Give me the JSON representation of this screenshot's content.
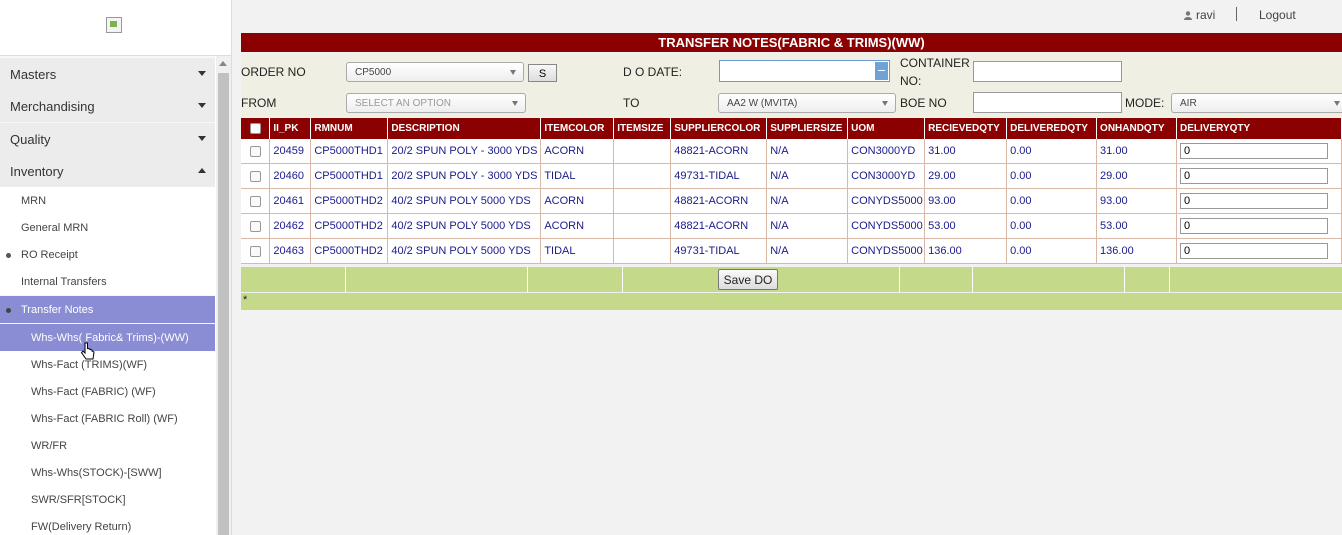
{
  "header": {
    "username": "ravi",
    "logout": "Logout"
  },
  "sidebar": {
    "menu": [
      {
        "label": "Masters"
      },
      {
        "label": "Merchandising"
      },
      {
        "label": "Quality"
      },
      {
        "label": "Inventory"
      }
    ],
    "inventory_items": [
      {
        "label": "MRN"
      },
      {
        "label": "General MRN"
      },
      {
        "label": "RO Receipt"
      },
      {
        "label": "Internal Transfers"
      },
      {
        "label": "Transfer Notes"
      }
    ],
    "transfer_items": [
      {
        "label": "Whs-Whs( Fabric& Trims)-(WW)"
      },
      {
        "label": "Whs-Fact (TRIMS)(WF)"
      },
      {
        "label": "Whs-Fact (FABRIC) (WF)"
      },
      {
        "label": "Whs-Fact (FABRIC Roll) (WF)"
      },
      {
        "label": "WR/FR"
      },
      {
        "label": "Whs-Whs(STOCK)-[SWW]"
      },
      {
        "label": "SWR/SFR[STOCK]"
      },
      {
        "label": "FW(Delivery Return)"
      }
    ]
  },
  "page": {
    "title": "TRANSFER NOTES(FABRIC & TRIMS)(WW)"
  },
  "form": {
    "order_no_label": "ORDER NO",
    "order_no_value": "CP5000",
    "s_button": "S",
    "do_date_label": "D O DATE:",
    "container_label_1": "CONTAINER",
    "container_label_2": "NO:",
    "from_label": "FROM",
    "from_placeholder": "SELECT AN OPTION",
    "to_label": "TO",
    "to_value": "AA2 W (MVITA)",
    "boe_label": "BOE NO",
    "mode_label": "MODE:",
    "mode_value": "AIR"
  },
  "table": {
    "headers": [
      "II_PK",
      "RMNUM",
      "DESCRIPTION",
      "ITEMCOLOR",
      "ITEMSIZE",
      "SUPPLIERCOLOR",
      "SUPPLIERSIZE",
      "UOM",
      "RECIEVEDQTY",
      "DELIVEREDQTY",
      "ONHANDQTY",
      "DELIVERYQTY"
    ],
    "rows": [
      {
        "ii_pk": "20459",
        "rmnum": "CP5000THD1",
        "description": "20/2 SPUN POLY - 3000 YDS",
        "itemcolor": "ACORN",
        "itemsize": "",
        "suppliercolor": "48821-ACORN",
        "suppliersize": "N/A",
        "uom": "CON3000YD",
        "recievedqty": "31.00",
        "deliveredqty": "0.00",
        "onhandqty": "31.00",
        "deliveryqty": "0"
      },
      {
        "ii_pk": "20460",
        "rmnum": "CP5000THD1",
        "description": "20/2 SPUN POLY - 3000 YDS",
        "itemcolor": "TIDAL",
        "itemsize": "",
        "suppliercolor": "49731-TIDAL",
        "suppliersize": "N/A",
        "uom": "CON3000YD",
        "recievedqty": "29.00",
        "deliveredqty": "0.00",
        "onhandqty": "29.00",
        "deliveryqty": "0"
      },
      {
        "ii_pk": "20461",
        "rmnum": "CP5000THD2",
        "description": "40/2 SPUN POLY 5000 YDS",
        "itemcolor": "ACORN",
        "itemsize": "",
        "suppliercolor": "48821-ACORN",
        "suppliersize": "N/A",
        "uom": "CONYDS5000",
        "recievedqty": "93.00",
        "deliveredqty": "0.00",
        "onhandqty": "93.00",
        "deliveryqty": "0"
      },
      {
        "ii_pk": "20462",
        "rmnum": "CP5000THD2",
        "description": "40/2 SPUN POLY 5000 YDS",
        "itemcolor": "ACORN",
        "itemsize": "",
        "suppliercolor": "48821-ACORN",
        "suppliersize": "N/A",
        "uom": "CONYDS5000",
        "recievedqty": "53.00",
        "deliveredqty": "0.00",
        "onhandqty": "53.00",
        "deliveryqty": "0"
      },
      {
        "ii_pk": "20463",
        "rmnum": "CP5000THD2",
        "description": "40/2 SPUN POLY 5000 YDS",
        "itemcolor": "TIDAL",
        "itemsize": "",
        "suppliercolor": "49731-TIDAL",
        "suppliersize": "N/A",
        "uom": "CONYDS5000",
        "recievedqty": "136.00",
        "deliveredqty": "0.00",
        "onhandqty": "136.00",
        "deliveryqty": "0"
      }
    ]
  },
  "footer": {
    "save_label": "Save DO",
    "note": "*"
  },
  "colors": {
    "header_bg": "#8b0000",
    "footer_bg": "#c5d98a",
    "active_menu": "#8a8dd3"
  }
}
